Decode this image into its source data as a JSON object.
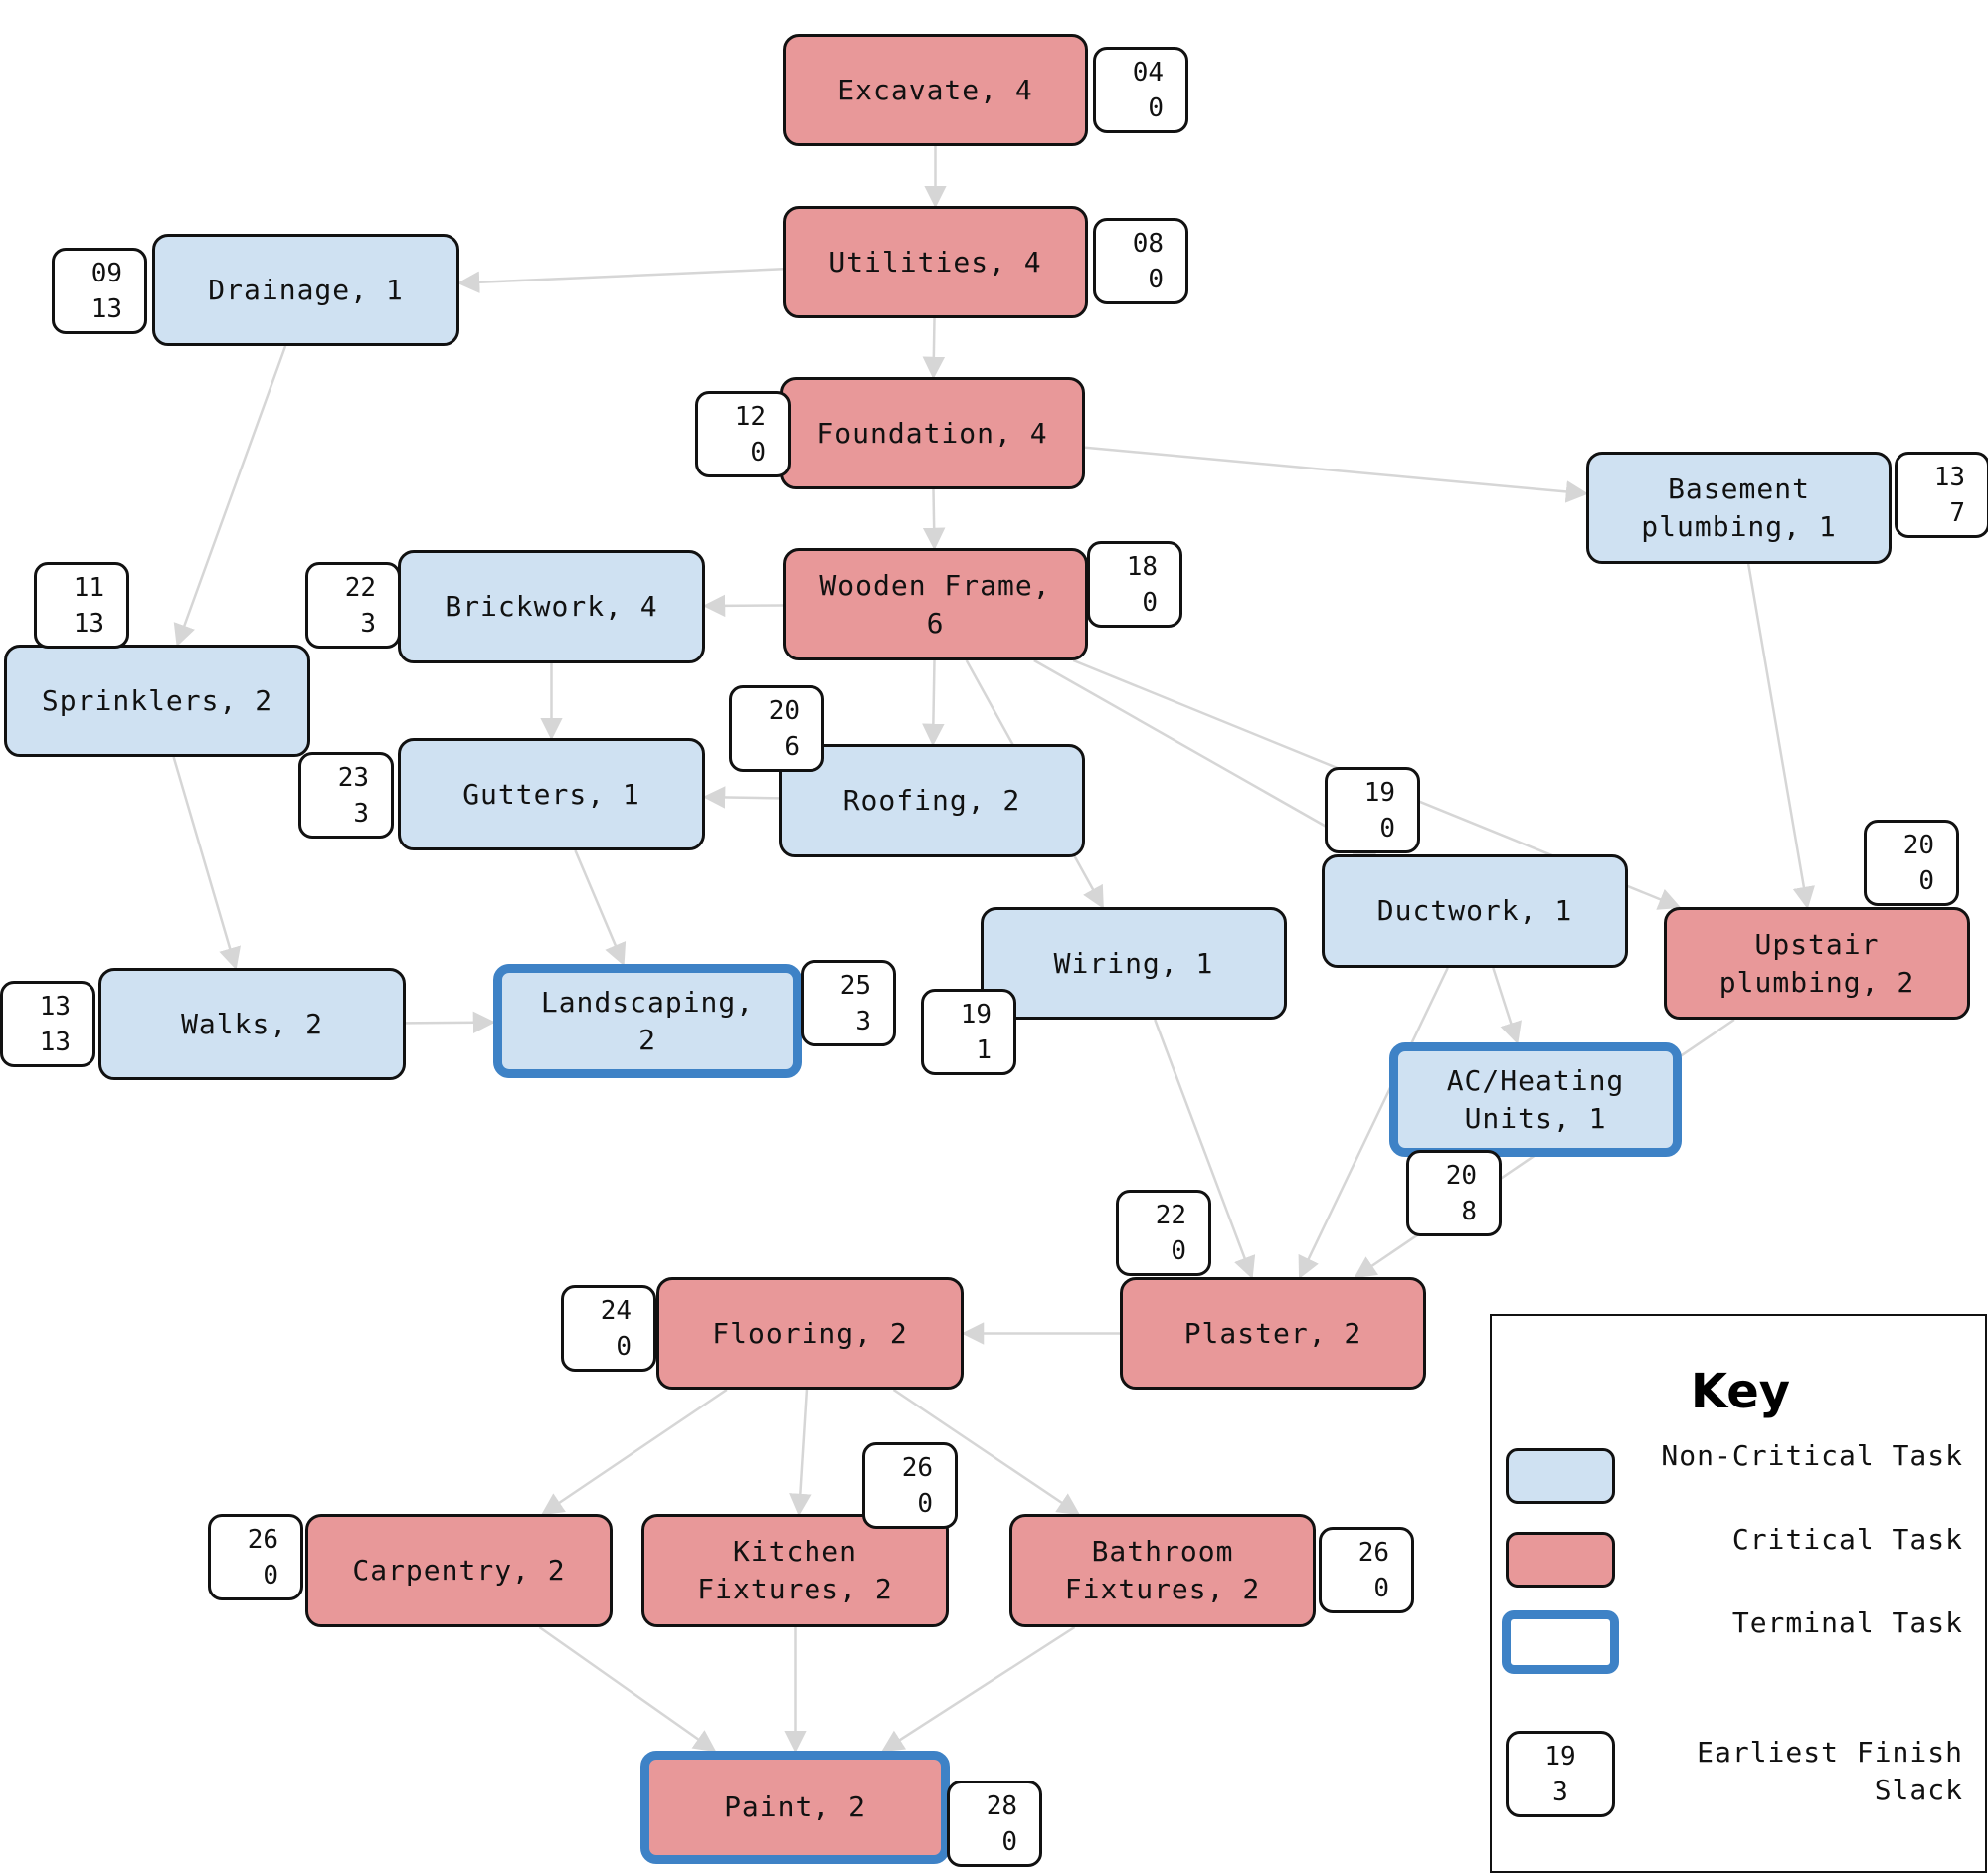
{
  "diagram": {
    "type": "critical-path-network",
    "colors": {
      "critical": "#e89899",
      "non_critical": "#cfe1f2",
      "terminal_border": "#3e82c6",
      "edge": "#d6d6d6"
    },
    "nodes": [
      {
        "id": "excavate",
        "label": "Excavate, 4",
        "critical": true,
        "terminal": false,
        "earliest_finish": "04",
        "slack": "0"
      },
      {
        "id": "utilities",
        "label": "Utilities, 4",
        "critical": true,
        "terminal": false,
        "earliest_finish": "08",
        "slack": "0"
      },
      {
        "id": "foundation",
        "label": "Foundation, 4",
        "critical": true,
        "terminal": false,
        "earliest_finish": "12",
        "slack": "0"
      },
      {
        "id": "wooden_frame",
        "label": "Wooden Frame,\n6",
        "critical": true,
        "terminal": false,
        "earliest_finish": "18",
        "slack": "0"
      },
      {
        "id": "drainage",
        "label": "Drainage, 1",
        "critical": false,
        "terminal": false,
        "earliest_finish": "09",
        "slack": "13"
      },
      {
        "id": "basement_plumbing",
        "label": "Basement\nplumbing, 1",
        "critical": false,
        "terminal": false,
        "earliest_finish": "13",
        "slack": "7"
      },
      {
        "id": "brickwork",
        "label": "Brickwork, 4",
        "critical": false,
        "terminal": false,
        "earliest_finish": "22",
        "slack": "3"
      },
      {
        "id": "sprinklers",
        "label": "Sprinklers, 2",
        "critical": false,
        "terminal": false,
        "earliest_finish": "11",
        "slack": "13"
      },
      {
        "id": "gutters",
        "label": "Gutters, 1",
        "critical": false,
        "terminal": false,
        "earliest_finish": "23",
        "slack": "3"
      },
      {
        "id": "roofing",
        "label": "Roofing, 2",
        "critical": false,
        "terminal": false,
        "earliest_finish": "20",
        "slack": "6"
      },
      {
        "id": "wiring",
        "label": "Wiring, 1",
        "critical": false,
        "terminal": false,
        "earliest_finish": "19",
        "slack": "1"
      },
      {
        "id": "ductwork",
        "label": "Ductwork, 1",
        "critical": false,
        "terminal": false,
        "earliest_finish": "19",
        "slack": "0"
      },
      {
        "id": "upstair_plumbing",
        "label": "Upstair\nplumbing, 2",
        "critical": true,
        "terminal": false,
        "earliest_finish": "20",
        "slack": "0"
      },
      {
        "id": "walks",
        "label": "Walks, 2",
        "critical": false,
        "terminal": false,
        "earliest_finish": "13",
        "slack": "13"
      },
      {
        "id": "landscaping",
        "label": "Landscaping,\n2",
        "critical": false,
        "terminal": true,
        "earliest_finish": "25",
        "slack": "3"
      },
      {
        "id": "ac_heating",
        "label": "AC/Heating\nUnits, 1",
        "critical": false,
        "terminal": true,
        "earliest_finish": "20",
        "slack": "8"
      },
      {
        "id": "plaster",
        "label": "Plaster, 2",
        "critical": true,
        "terminal": false,
        "earliest_finish": "22",
        "slack": "0"
      },
      {
        "id": "flooring",
        "label": "Flooring, 2",
        "critical": true,
        "terminal": false,
        "earliest_finish": "24",
        "slack": "0"
      },
      {
        "id": "carpentry",
        "label": "Carpentry, 2",
        "critical": true,
        "terminal": false,
        "earliest_finish": "26",
        "slack": "0"
      },
      {
        "id": "kitchen_fixtures",
        "label": "Kitchen\nFixtures, 2",
        "critical": true,
        "terminal": false,
        "earliest_finish": "26",
        "slack": "0"
      },
      {
        "id": "bathroom_fixtures",
        "label": "Bathroom\nFixtures, 2",
        "critical": true,
        "terminal": false,
        "earliest_finish": "26",
        "slack": "0"
      },
      {
        "id": "paint",
        "label": "Paint, 2",
        "critical": true,
        "terminal": true,
        "earliest_finish": "28",
        "slack": "0"
      }
    ],
    "edges": [
      [
        "excavate",
        "utilities"
      ],
      [
        "utilities",
        "foundation"
      ],
      [
        "utilities",
        "drainage"
      ],
      [
        "foundation",
        "wooden_frame"
      ],
      [
        "foundation",
        "basement_plumbing"
      ],
      [
        "drainage",
        "sprinklers"
      ],
      [
        "wooden_frame",
        "brickwork"
      ],
      [
        "wooden_frame",
        "roofing"
      ],
      [
        "wooden_frame",
        "wiring"
      ],
      [
        "wooden_frame",
        "ductwork"
      ],
      [
        "wooden_frame",
        "upstair_plumbing"
      ],
      [
        "basement_plumbing",
        "upstair_plumbing"
      ],
      [
        "brickwork",
        "gutters"
      ],
      [
        "roofing",
        "gutters"
      ],
      [
        "sprinklers",
        "walks"
      ],
      [
        "walks",
        "landscaping"
      ],
      [
        "gutters",
        "landscaping"
      ],
      [
        "ductwork",
        "ac_heating"
      ],
      [
        "ductwork",
        "plaster"
      ],
      [
        "wiring",
        "plaster"
      ],
      [
        "upstair_plumbing",
        "plaster"
      ],
      [
        "plaster",
        "flooring"
      ],
      [
        "flooring",
        "carpentry"
      ],
      [
        "flooring",
        "kitchen_fixtures"
      ],
      [
        "flooring",
        "bathroom_fixtures"
      ],
      [
        "carpentry",
        "paint"
      ],
      [
        "kitchen_fixtures",
        "paint"
      ],
      [
        "bathroom_fixtures",
        "paint"
      ]
    ]
  },
  "key": {
    "title": "Key",
    "items": [
      {
        "id": "non_critical",
        "label": "Non-Critical Task"
      },
      {
        "id": "critical",
        "label": "Critical Task"
      },
      {
        "id": "terminal",
        "label": "Terminal Task"
      },
      {
        "id": "badge",
        "label": "Earliest Finish\nSlack",
        "sample_earliest_finish": "19",
        "sample_slack": "3"
      }
    ]
  }
}
